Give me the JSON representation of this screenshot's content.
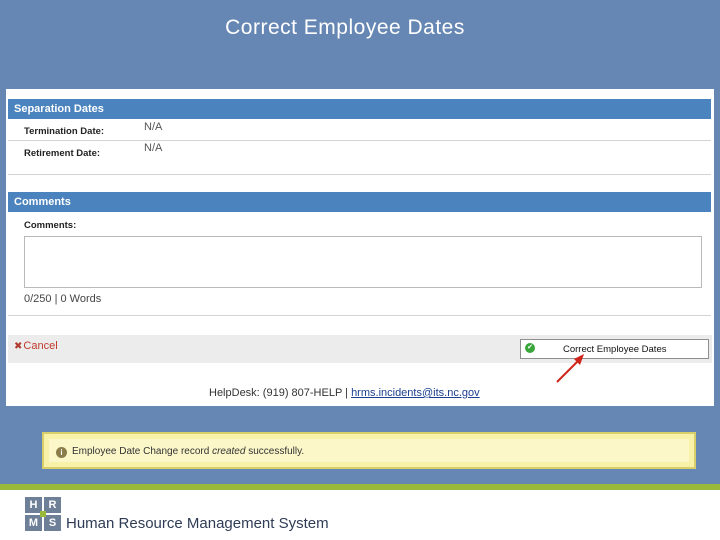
{
  "slide": {
    "title": "Correct Employee Dates"
  },
  "separation_dates": {
    "header": "Separation Dates",
    "fields": [
      {
        "label": "Termination Date:",
        "value": "N/A"
      },
      {
        "label": "Retirement Date:",
        "value": "N/A"
      }
    ]
  },
  "comments": {
    "header": "Comments",
    "label": "Comments:",
    "value": "",
    "word_count": "0/250 | 0 Words"
  },
  "actions": {
    "cancel_label": "Cancel",
    "submit_label": "Correct Employee Dates"
  },
  "helpdesk": {
    "prefix": "HelpDesk: (919) 807-HELP | ",
    "email": "hrms.incidents@its.nc.gov"
  },
  "notification": {
    "message_prefix": "Employee Date Change record ",
    "message_emphasis": "created",
    "message_suffix": " successfully."
  },
  "footer": {
    "logo_letters": [
      "H",
      "R",
      "M",
      "S"
    ],
    "system_name": "Human Resource Management System"
  },
  "colors": {
    "slide_background": "#6687b3",
    "section_header": "#4a83bd",
    "annotation_arrow": "#d0241b",
    "success_background": "#fbf7c9",
    "footer_accent": "#9ab93a"
  },
  "icons": {
    "cancel": "close-x-icon",
    "submit": "green-check-icon",
    "notification": "info-icon"
  }
}
